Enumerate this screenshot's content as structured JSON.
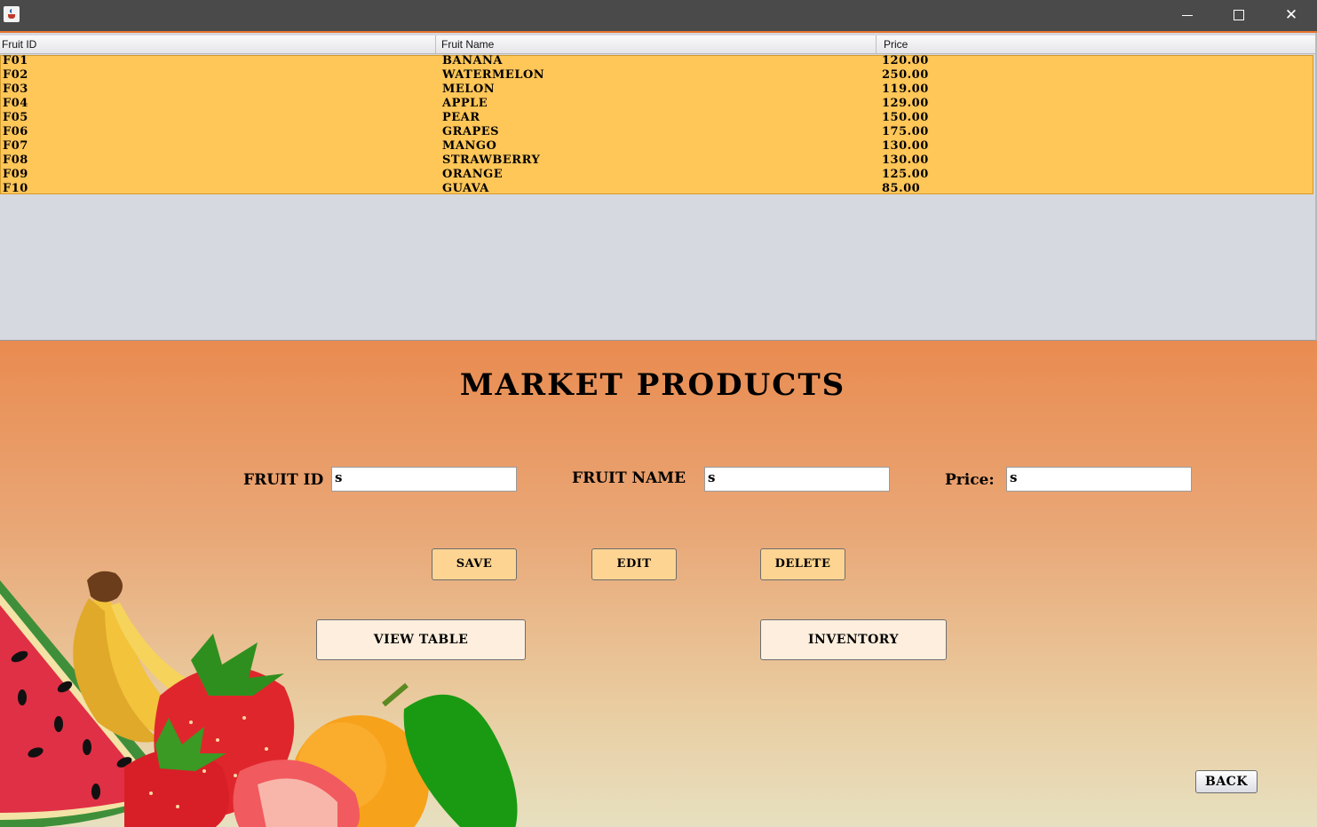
{
  "window": {
    "title": "",
    "controls": {
      "minimize": "minimize-icon",
      "maximize": "maximize-icon",
      "close": "close-icon"
    }
  },
  "table": {
    "columns": [
      "Fruit ID",
      "Fruit Name",
      "Price"
    ],
    "rows": [
      [
        "F01",
        "BANANA",
        "120.00"
      ],
      [
        "F02",
        "WATERMELON",
        "250.00"
      ],
      [
        "F03",
        "MELON",
        "119.00"
      ],
      [
        "F04",
        "APPLE",
        "129.00"
      ],
      [
        "F05",
        "PEAR",
        "150.00"
      ],
      [
        "F06",
        "GRAPES",
        "175.00"
      ],
      [
        "F07",
        "MANGO",
        "130.00"
      ],
      [
        "F08",
        "STRAWBERRY",
        "130.00"
      ],
      [
        "F09",
        "ORANGE",
        "125.00"
      ],
      [
        "F10",
        "GUAVA",
        "85.00"
      ]
    ]
  },
  "form": {
    "heading": "MARKET PRODUCTS",
    "fruit_id_label": "FRUIT ID",
    "fruit_id_value": "s",
    "fruit_name_label": "FRUIT NAME",
    "fruit_name_value": "s",
    "price_label": "Price:",
    "price_value": "s"
  },
  "buttons": {
    "save": "SAVE",
    "edit": "EDIT",
    "delete": "DELETE",
    "view_table": "VIEW TABLE",
    "inventory": "INVENTORY",
    "back": "BACK"
  },
  "colors": {
    "titlebar": "#4a4a4a",
    "accent": "#e8732c",
    "row_highlight": "#ffc658",
    "button_small": "#fdd491",
    "button_big": "#fdeedd"
  },
  "decorations": [
    "watermelon-slice",
    "banana-bunch",
    "strawberry",
    "orange",
    "leaf"
  ]
}
